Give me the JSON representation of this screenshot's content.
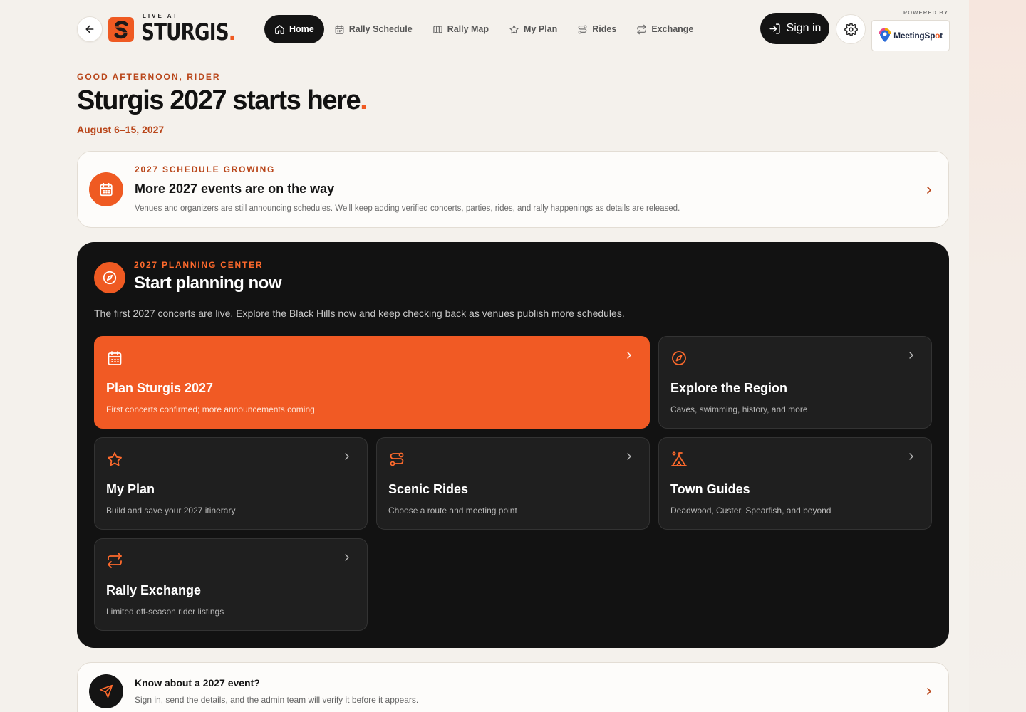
{
  "header": {
    "back_icon": "arrow-left-icon",
    "logo": {
      "top_text": "LIVE AT",
      "wordmark": "STURGIS",
      "dot": "."
    },
    "nav": [
      {
        "label": "Home",
        "icon": "home-icon",
        "active": true
      },
      {
        "label": "Rally Schedule",
        "icon": "calendar-icon",
        "active": false
      },
      {
        "label": "Rally Map",
        "icon": "map-icon",
        "active": false
      },
      {
        "label": "My Plan",
        "icon": "star-icon",
        "active": false
      },
      {
        "label": "Rides",
        "icon": "route-icon",
        "active": false
      },
      {
        "label": "Exchange",
        "icon": "repeat-icon",
        "active": false
      }
    ],
    "signin_label": "Sign in",
    "powered_by": "POWERED BY",
    "partner": {
      "name_part1": "MeetingSp",
      "name_o": "o",
      "name_part2": "t"
    }
  },
  "greeting": {
    "eyebrow": "GOOD AFTERNOON, RIDER",
    "title": "Sturgis 2027 starts here",
    "title_dot": ".",
    "dates": "August 6–15, 2027"
  },
  "notice": {
    "eyebrow": "2027 SCHEDULE GROWING",
    "title": "More 2027 events are on the way",
    "description": "Venues and organizers are still announcing schedules. We'll keep adding verified concerts, parties, rides, and rally happenings as details are released."
  },
  "planning": {
    "eyebrow": "2027 PLANNING CENTER",
    "title": "Start planning now",
    "description": "The first 2027 concerts are live. Explore the Black Hills now and keep checking back as venues publish more schedules.",
    "tiles": [
      {
        "title": "Plan Sturgis 2027",
        "description": "First concerts confirmed; more announcements coming",
        "icon": "calendar-icon"
      },
      {
        "title": "Explore the Region",
        "description": "Caves, swimming, history, and more",
        "icon": "compass-icon"
      },
      {
        "title": "My Plan",
        "description": "Build and save your 2027 itinerary",
        "icon": "star-icon"
      },
      {
        "title": "Scenic Rides",
        "description": "Choose a route and meeting point",
        "icon": "route-icon"
      },
      {
        "title": "Town Guides",
        "description": "Deadwood, Custer, Spearfish, and beyond",
        "icon": "tent-icon"
      },
      {
        "title": "Rally Exchange",
        "description": "Limited off-season rider listings",
        "icon": "repeat-icon"
      }
    ]
  },
  "submit_event": {
    "title": "Know about a 2027 event?",
    "description": "Sign in, send the details, and the admin team will verify it before it appears."
  },
  "colors": {
    "accent": "#ef5a22",
    "dark": "#121212",
    "eyebrow": "#b9461a",
    "background": "#f4f1ec"
  }
}
